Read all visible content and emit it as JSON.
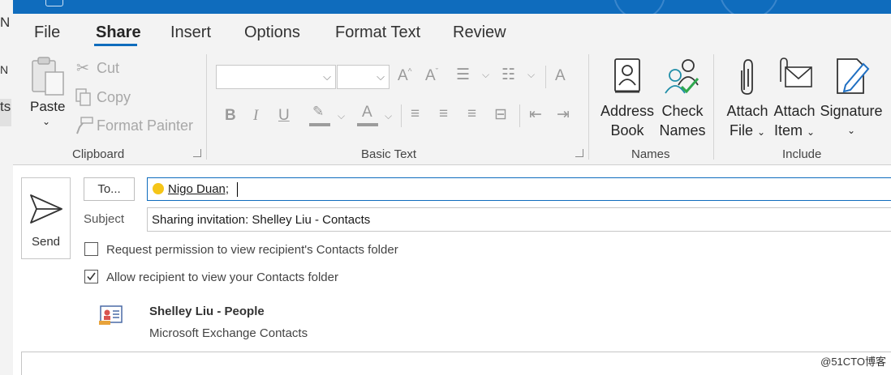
{
  "background_window": {
    "fragments": [
      "N",
      "N",
      "ts"
    ]
  },
  "tabs": [
    {
      "label": "File",
      "active": false
    },
    {
      "label": "Share",
      "active": true
    },
    {
      "label": "Insert",
      "active": false
    },
    {
      "label": "Options",
      "active": false
    },
    {
      "label": "Format Text",
      "active": false
    },
    {
      "label": "Review",
      "active": false
    }
  ],
  "clipboard": {
    "paste_label": "Paste",
    "cut_label": "Cut",
    "copy_label": "Copy",
    "format_painter_label": "Format Painter",
    "group_label": "Clipboard"
  },
  "basic_text": {
    "font_name": "",
    "font_size": "",
    "group_label": "Basic Text"
  },
  "names": {
    "address_book_line1": "Address",
    "address_book_line2": "Book",
    "check_names_line1": "Check",
    "check_names_line2": "Names",
    "group_label": "Names"
  },
  "include": {
    "attach_file_line1": "Attach",
    "attach_file_line2": "File",
    "attach_item_line1": "Attach",
    "attach_item_line2": "Item",
    "signature_label": "Signature",
    "group_label": "Include"
  },
  "message": {
    "send_label": "Send",
    "to_button_label": "To...",
    "to_recipient": "Nigo Duan;",
    "subject_label": "Subject",
    "subject_value": "Sharing invitation: Shelley Liu - Contacts",
    "request_permission_label": "Request permission to view recipient's Contacts folder",
    "request_permission_checked": false,
    "allow_view_label": "Allow recipient to view your Contacts folder",
    "allow_view_checked": true,
    "attachment_title": "Shelley Liu - People",
    "attachment_subtitle": "Microsoft Exchange Contacts"
  },
  "watermark": "@51CTO博客",
  "colors": {
    "accent": "#0f6cbd",
    "ribbon_bg": "#f3f3f3",
    "disabled_text": "#a8a8a8",
    "presence_yellow": "#f5c518",
    "check_green": "#2fa84f",
    "icon_teal": "#1f8ea8"
  }
}
